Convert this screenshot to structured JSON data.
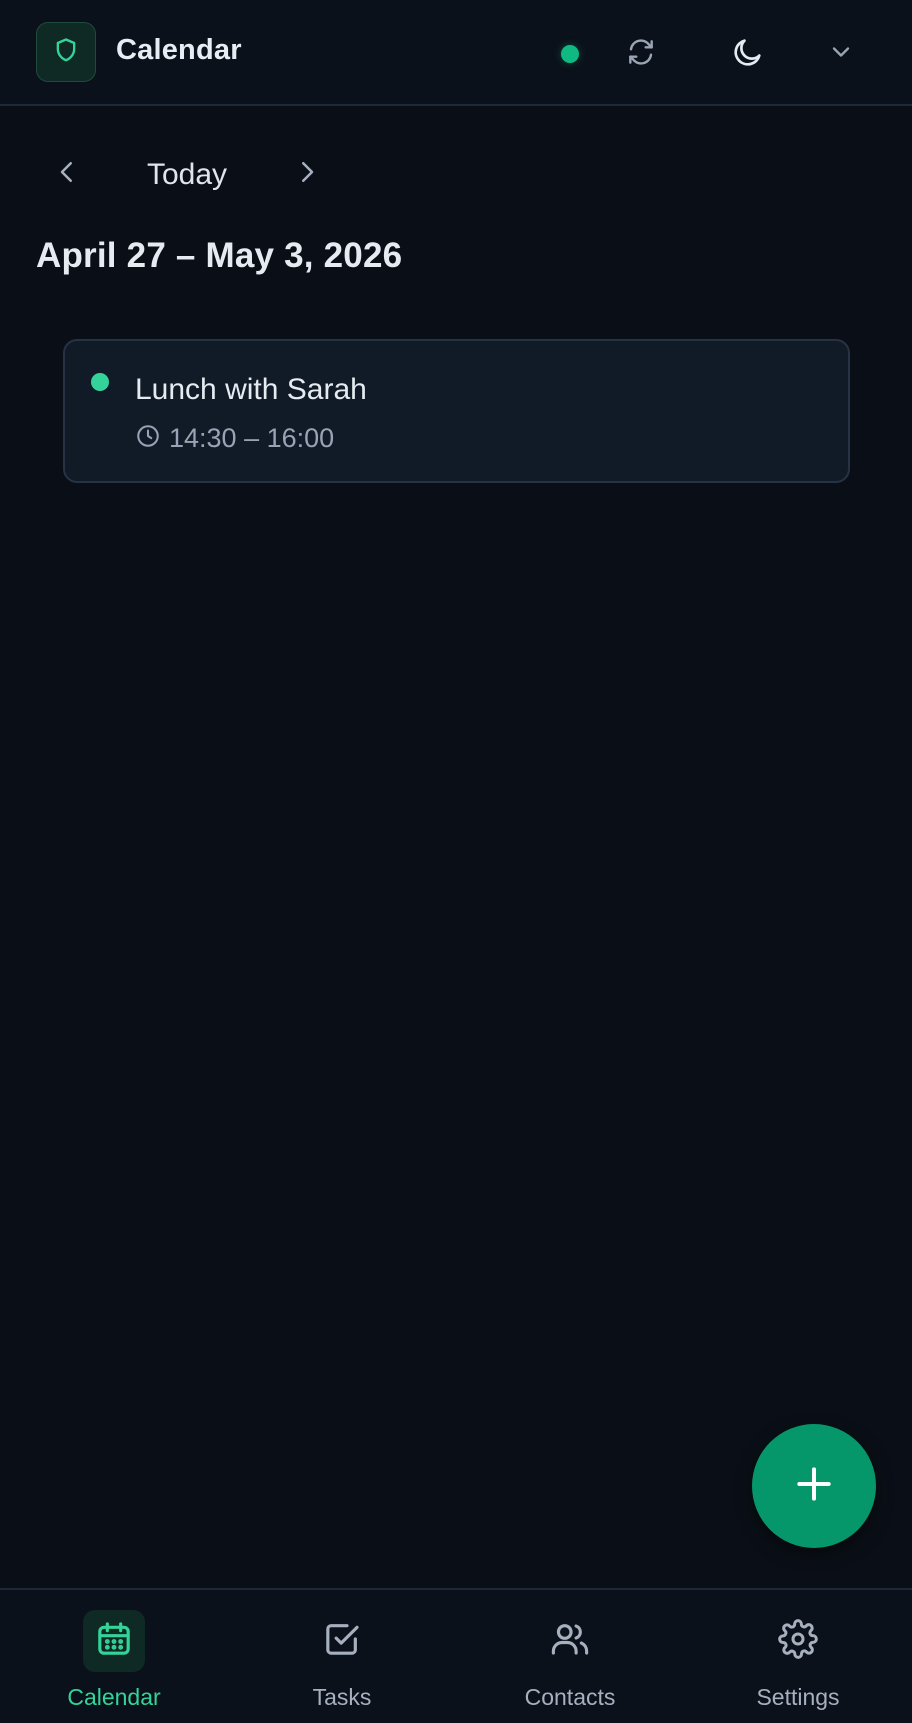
{
  "header": {
    "title": "Calendar",
    "logo_icon": "shield-icon",
    "status": "online",
    "status_color": "#10b981",
    "sync_icon": "refresh-icon",
    "theme_icon": "moon-icon",
    "menu_icon": "chevron-down-icon"
  },
  "navigation": {
    "prev_icon": "chevron-left-icon",
    "today_label": "Today",
    "next_icon": "chevron-right-icon"
  },
  "date_range": "April 27 – May 3, 2026",
  "events": [
    {
      "title": "Lunch with Sarah",
      "time": "14:30 – 16:00",
      "color": "#34d399"
    }
  ],
  "fab": {
    "icon": "plus-icon",
    "color": "#059669"
  },
  "bottom_nav": {
    "items": [
      {
        "label": "Calendar",
        "icon": "calendar-icon",
        "active": true
      },
      {
        "label": "Tasks",
        "icon": "checkbox-icon",
        "active": false
      },
      {
        "label": "Contacts",
        "icon": "users-icon",
        "active": false
      },
      {
        "label": "Settings",
        "icon": "gear-icon",
        "active": false
      }
    ],
    "active_color": "#34d399"
  }
}
